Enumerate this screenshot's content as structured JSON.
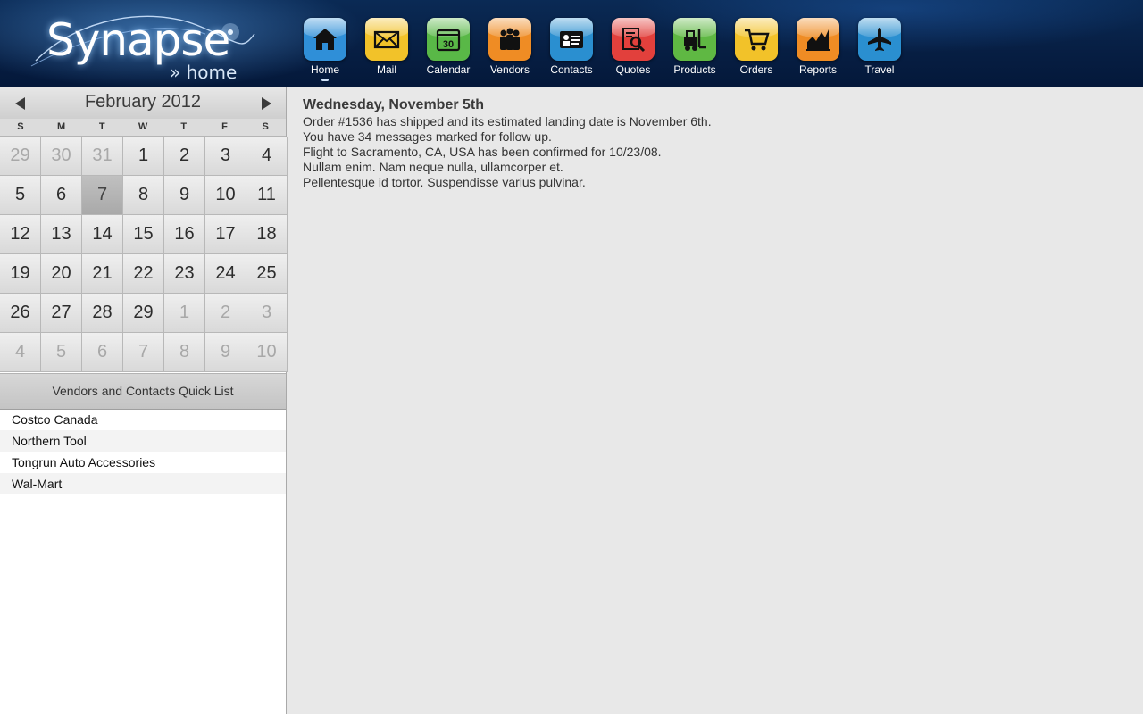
{
  "app": {
    "logo_text": "Synapse",
    "logo_sub": "» home"
  },
  "nav": [
    {
      "label": "Home",
      "icon": "home-icon",
      "color": "#2f8fd8",
      "active": true
    },
    {
      "label": "Mail",
      "icon": "mail-icon",
      "color": "#f2c229"
    },
    {
      "label": "Calendar",
      "icon": "calendar-icon",
      "color": "#59b847"
    },
    {
      "label": "Vendors",
      "icon": "vendors-icon",
      "color": "#ef8c24"
    },
    {
      "label": "Contacts",
      "icon": "contacts-icon",
      "color": "#2a8fd0"
    },
    {
      "label": "Quotes",
      "icon": "quotes-icon",
      "color": "#e2403c"
    },
    {
      "label": "Products",
      "icon": "forklift-icon",
      "color": "#5fb843"
    },
    {
      "label": "Orders",
      "icon": "cart-icon",
      "color": "#f2c229"
    },
    {
      "label": "Reports",
      "icon": "chart-icon",
      "color": "#ef8c24"
    },
    {
      "label": "Travel",
      "icon": "plane-icon",
      "color": "#2a8fd0"
    }
  ],
  "calendar": {
    "month_title": "February 2012",
    "weekdays": [
      "S",
      "M",
      "T",
      "W",
      "T",
      "F",
      "S"
    ],
    "calendar_icon_text": "30",
    "days": [
      {
        "d": "29",
        "other": true
      },
      {
        "d": "30",
        "other": true
      },
      {
        "d": "31",
        "other": true
      },
      {
        "d": "1"
      },
      {
        "d": "2"
      },
      {
        "d": "3"
      },
      {
        "d": "4"
      },
      {
        "d": "5"
      },
      {
        "d": "6"
      },
      {
        "d": "7",
        "today": true
      },
      {
        "d": "8"
      },
      {
        "d": "9"
      },
      {
        "d": "10"
      },
      {
        "d": "11"
      },
      {
        "d": "12"
      },
      {
        "d": "13"
      },
      {
        "d": "14"
      },
      {
        "d": "15"
      },
      {
        "d": "16"
      },
      {
        "d": "17"
      },
      {
        "d": "18"
      },
      {
        "d": "19"
      },
      {
        "d": "20"
      },
      {
        "d": "21"
      },
      {
        "d": "22"
      },
      {
        "d": "23"
      },
      {
        "d": "24"
      },
      {
        "d": "25"
      },
      {
        "d": "26"
      },
      {
        "d": "27"
      },
      {
        "d": "28"
      },
      {
        "d": "29"
      },
      {
        "d": "1",
        "other": true
      },
      {
        "d": "2",
        "other": true
      },
      {
        "d": "3",
        "other": true
      },
      {
        "d": "4",
        "other": true
      },
      {
        "d": "5",
        "other": true
      },
      {
        "d": "6",
        "other": true
      },
      {
        "d": "7",
        "other": true
      },
      {
        "d": "8",
        "other": true
      },
      {
        "d": "9",
        "other": true
      },
      {
        "d": "10",
        "other": true
      }
    ]
  },
  "quick_list": {
    "title": "Vendors and Contacts Quick List",
    "items": [
      "Costco Canada",
      "Northern Tool",
      "Tongrun Auto Accessories",
      "Wal-Mart"
    ]
  },
  "main": {
    "date_heading": "Wednesday, November 5th",
    "lines": [
      "Order #1536 has shipped and its estimated landing date is November 6th.",
      "You have 34 messages marked for follow up.",
      "Flight to Sacramento, CA, USA has been confirmed for 10/23/08.",
      "Nullam enim. Nam neque nulla, ullamcorper et.",
      "Pellentesque id tortor. Suspendisse varius pulvinar."
    ]
  }
}
